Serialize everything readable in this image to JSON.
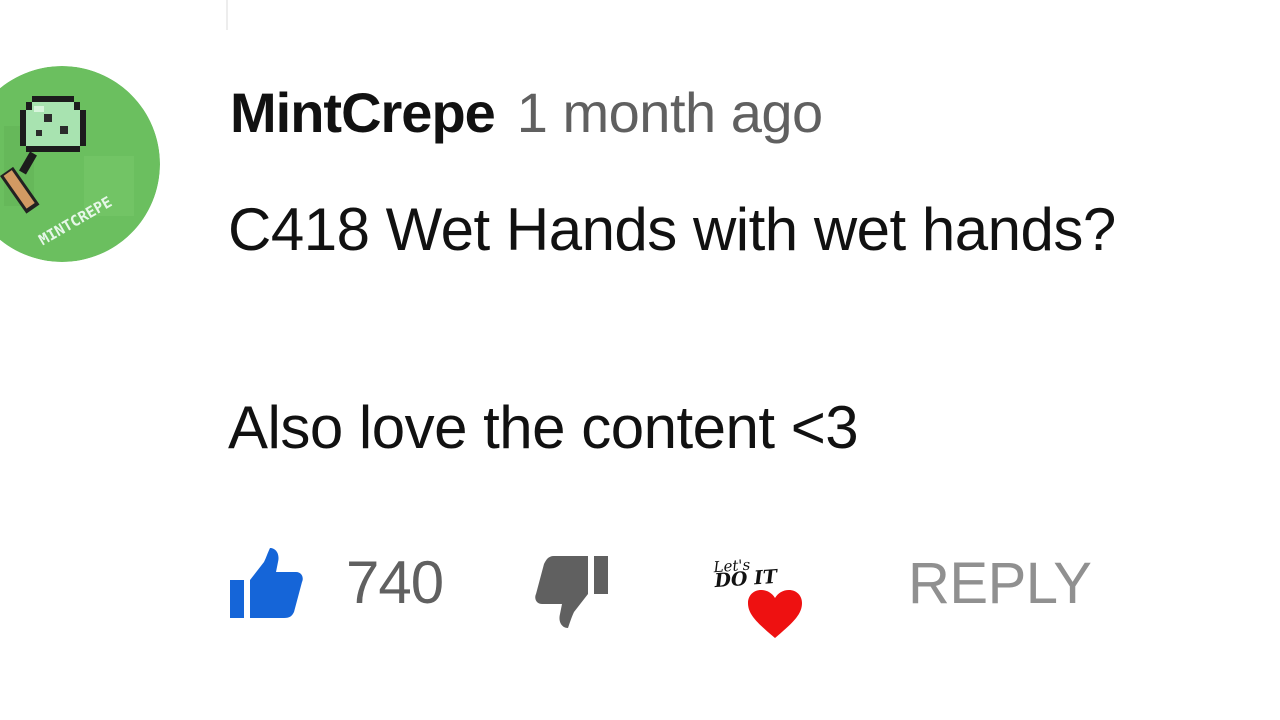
{
  "comment": {
    "author": "MintCrepe",
    "timestamp": "1 month ago",
    "text_lines": [
      "C418 Wet Hands with wet hands?",
      "Also love the content <3"
    ],
    "avatar": {
      "icon": "pixel-ice-cream-icon",
      "caption": "MINTCREPE",
      "background_color": "#6bbf5f"
    }
  },
  "actions": {
    "like_count": "740",
    "like_icon": "thumbs-up-icon",
    "like_color": "#1565d8",
    "dislike_icon": "thumbs-down-icon",
    "creator_heart": {
      "caption_line_1": "Let's",
      "caption_line_2": "DO IT",
      "icon": "heart-icon",
      "color": "#ee1111"
    },
    "reply_label": "REPLY"
  }
}
